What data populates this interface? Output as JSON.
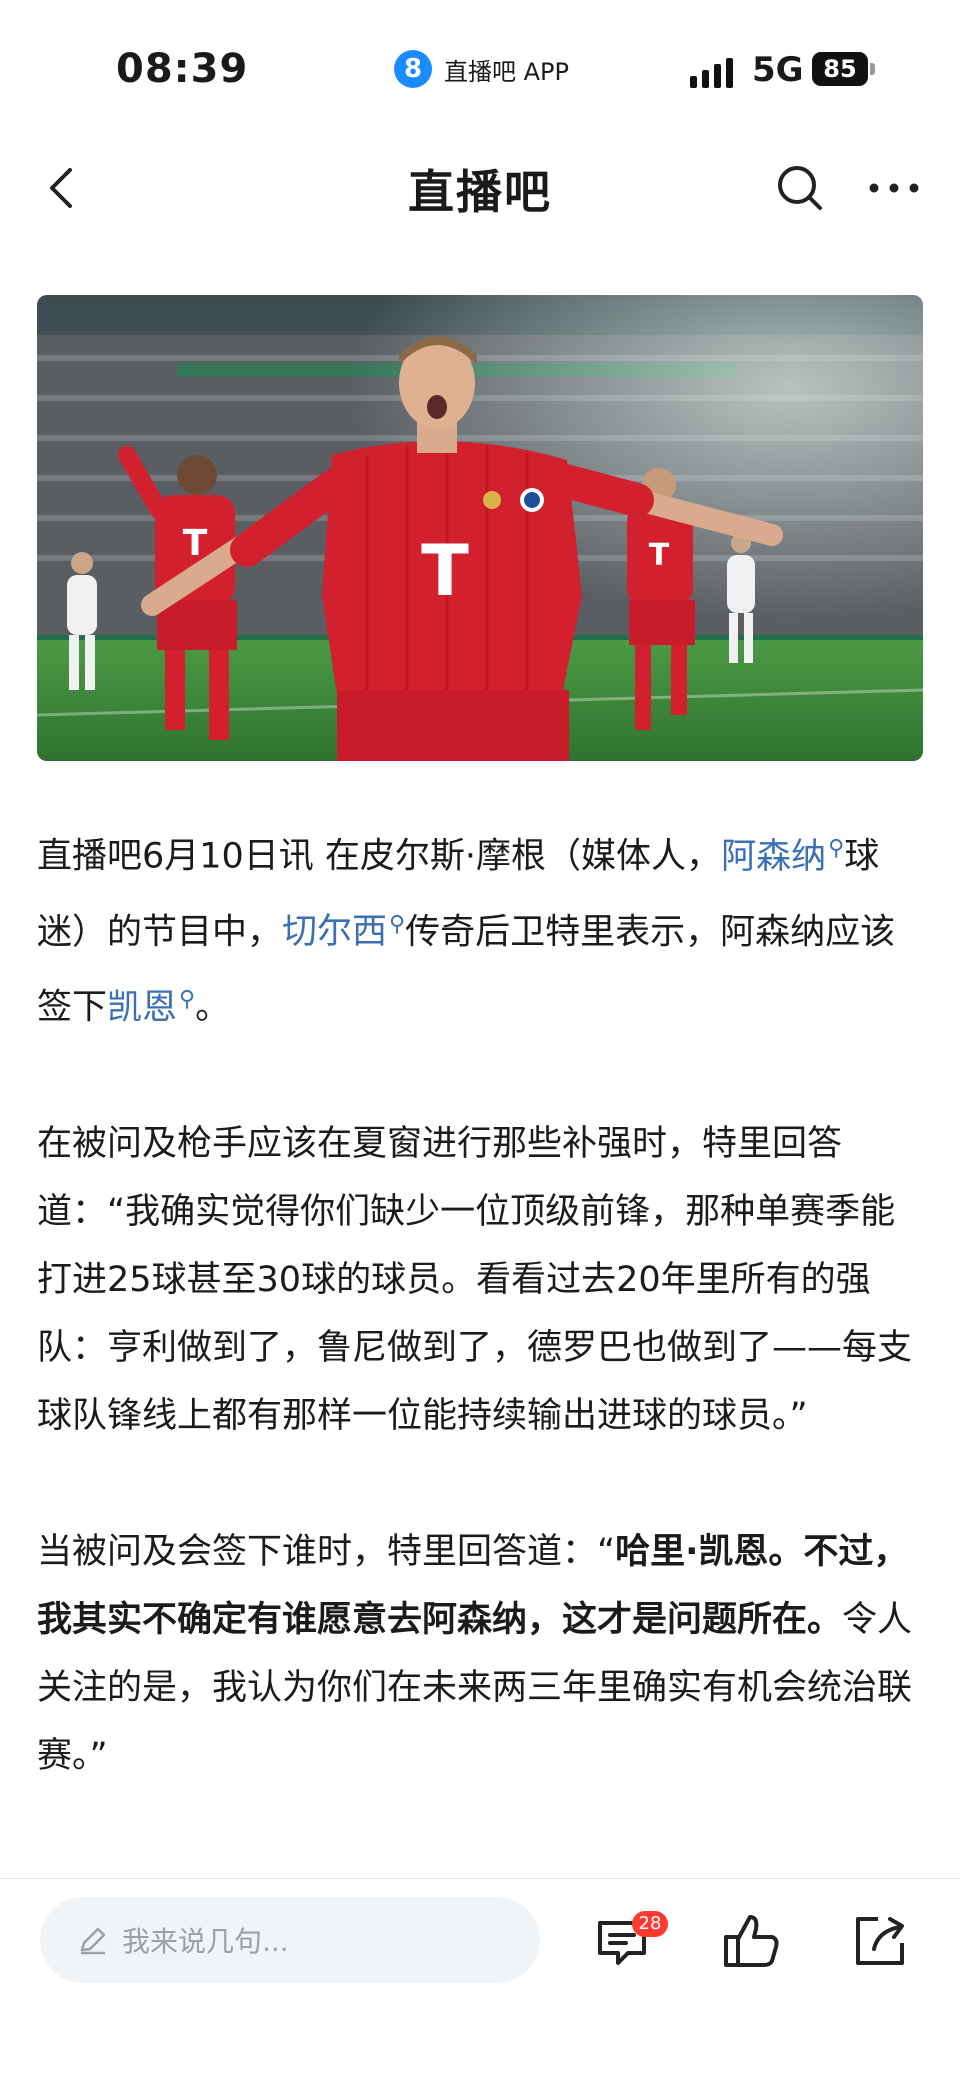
{
  "status_bar": {
    "time": "08:39",
    "app_logo_glyph": "8",
    "app_name": "直播吧 APP",
    "network": "5G",
    "battery": "85"
  },
  "nav": {
    "title": "直播吧",
    "back_icon": "chevron-left-icon",
    "search_icon": "search-icon",
    "more_icon": "more-icon"
  },
  "article": {
    "p1": {
      "a": "直播吧6月10日讯 在皮尔斯·摩根（媒体人，",
      "link1": "阿森纳",
      "b": "球迷）的节目中，",
      "link2": "切尔西",
      "c": "传奇后卫特里表示，阿森纳应该签下",
      "link3": "凯恩",
      "d": "。"
    },
    "p2": "在被问及枪手应该在夏窗进行那些补强时，特里回答道：“我确实觉得你们缺少一位顶级前锋，那种单赛季能打进25球甚至30球的球员。看看过去20年里所有的强队：亨利做到了，鲁尼做到了，德罗巴也做到了——每支球队锋线上都有那样一位能持续输出进球的球员。”",
    "p3": {
      "a": "当被问及会签下谁时，特里回答道：“",
      "bold": "哈里·凯恩。不过，我其实不确定有谁愿意去阿森纳，这才是问题所在。",
      "b": "令人关注的是，我认为你们在未来两三年里确实有机会统治联赛。”"
    }
  },
  "bottom_bar": {
    "comment_placeholder": "我来说几句...",
    "comment_count": "28"
  },
  "colors": {
    "link": "#3b6fb6",
    "badge": "#ff3b30",
    "kit_red": "#d3202f",
    "pitch": "#3f8a3a"
  }
}
